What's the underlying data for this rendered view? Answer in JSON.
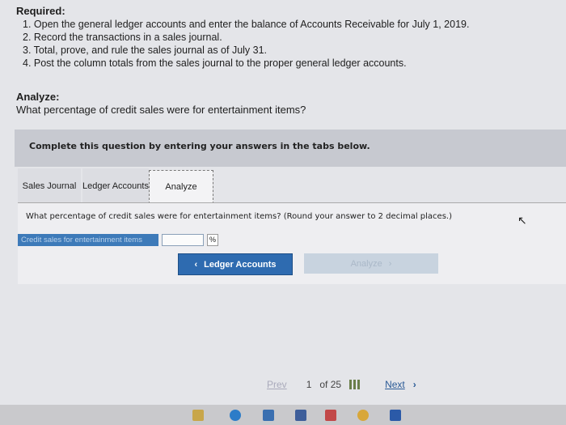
{
  "required": {
    "heading": "Required:",
    "items": [
      "1. Open the general ledger accounts and enter the balance of Accounts Receivable for July 1, 2019.",
      "2. Record the transactions in a sales journal.",
      "3. Total, prove, and rule the sales journal as of July 31.",
      "4. Post the column totals from the sales journal to the proper general ledger accounts."
    ]
  },
  "analyze": {
    "heading": "Analyze:",
    "question": "What percentage of credit sales were for entertainment items?"
  },
  "banner": "Complete this question by entering your answers in the tabs below.",
  "tabs": [
    {
      "label": "Sales Journal"
    },
    {
      "label": "Ledger Accounts"
    },
    {
      "label": "Analyze"
    }
  ],
  "panel": {
    "question": "What percentage of credit sales were for entertainment items? (Round your answer to 2 decimal places.)",
    "field_label": "Credit sales for entertainment items",
    "field_value": "",
    "unit": "%"
  },
  "nav": {
    "prev_label": "Ledger Accounts",
    "next_label": "Analyze"
  },
  "pager": {
    "prev": "Prev",
    "current": "1",
    "of": "of 25",
    "next": "Next"
  },
  "colors": {
    "accent": "#2e6bb0",
    "label_bg": "#3d7ab9"
  }
}
